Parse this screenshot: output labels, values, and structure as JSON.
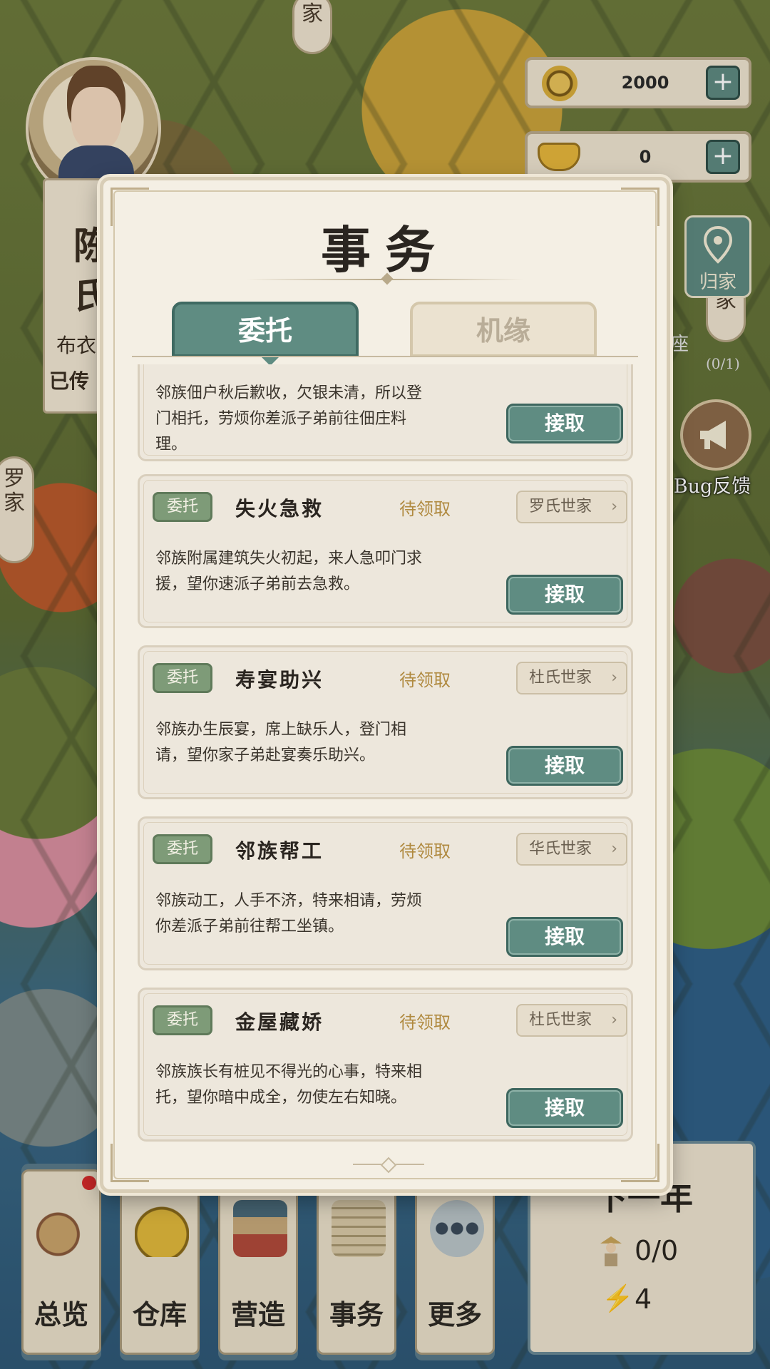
{
  "background": {
    "top_clan_tag": "家",
    "left_clan_tag": "罗家",
    "right_clan_tag": "家",
    "left_panel_fragments": [
      "陈",
      "氏",
      "布衣",
      "已传"
    ],
    "right_fragments": [
      "座",
      "(0/1)"
    ]
  },
  "currency": {
    "coins": "2000",
    "ingots": "0",
    "plus_label": "+"
  },
  "side_buttons": {
    "home_label": "归家",
    "bug_label": "Bug反馈"
  },
  "dialog": {
    "title": "事务",
    "tabs": [
      {
        "label": "委托",
        "active": true
      },
      {
        "label": "机缘",
        "active": false
      }
    ],
    "tasks": [
      {
        "badge": "",
        "title": "",
        "status": "",
        "clan": "",
        "description_lines": [
          "邻族佃户秋后歉收，欠银未清，所以登",
          "门相托，劳烦你差派子弟前往佃庄料",
          "理。"
        ],
        "accept_label": "接取",
        "partial": true
      },
      {
        "badge": "委托",
        "title": "失火急救",
        "status": "待领取",
        "clan": "罗氏世家",
        "description_lines": [
          "邻族附属建筑失火初起，来人急叩门求",
          "援，望你速派子弟前去急救。"
        ],
        "accept_label": "接取"
      },
      {
        "badge": "委托",
        "title": "寿宴助兴",
        "status": "待领取",
        "clan": "杜氏世家",
        "description_lines": [
          "邻族办生辰宴，席上缺乐人，登门相",
          "请，望你家子弟赴宴奏乐助兴。"
        ],
        "accept_label": "接取"
      },
      {
        "badge": "委托",
        "title": "邻族帮工",
        "status": "待领取",
        "clan": "华氏世家",
        "description_lines": [
          "邻族动工，人手不济，特来相请，劳烦",
          "你差派子弟前往帮工坐镇。"
        ],
        "accept_label": "接取"
      },
      {
        "badge": "委托",
        "title": "金屋藏娇",
        "status": "待领取",
        "clan": "杜氏世家",
        "description_lines": [
          "邻族族长有桩见不得光的心事，特来相",
          "托，望你暗中成全，勿使左右知晓。"
        ],
        "accept_label": "接取"
      }
    ]
  },
  "bottom_nav": [
    {
      "label": "总览",
      "badge": true
    },
    {
      "label": "仓库",
      "badge": false
    },
    {
      "label": "营造",
      "badge": false
    },
    {
      "label": "事务",
      "badge": false
    },
    {
      "label": "更多",
      "badge": true
    }
  ],
  "year_panel": {
    "title": "下一年",
    "population": "0/0",
    "energy": "4"
  },
  "colors": {
    "accent_teal": "#5f8c82",
    "status_gold": "#b08a40",
    "badge_green": "#7e9b78",
    "notification_red": "#d62b2b"
  }
}
